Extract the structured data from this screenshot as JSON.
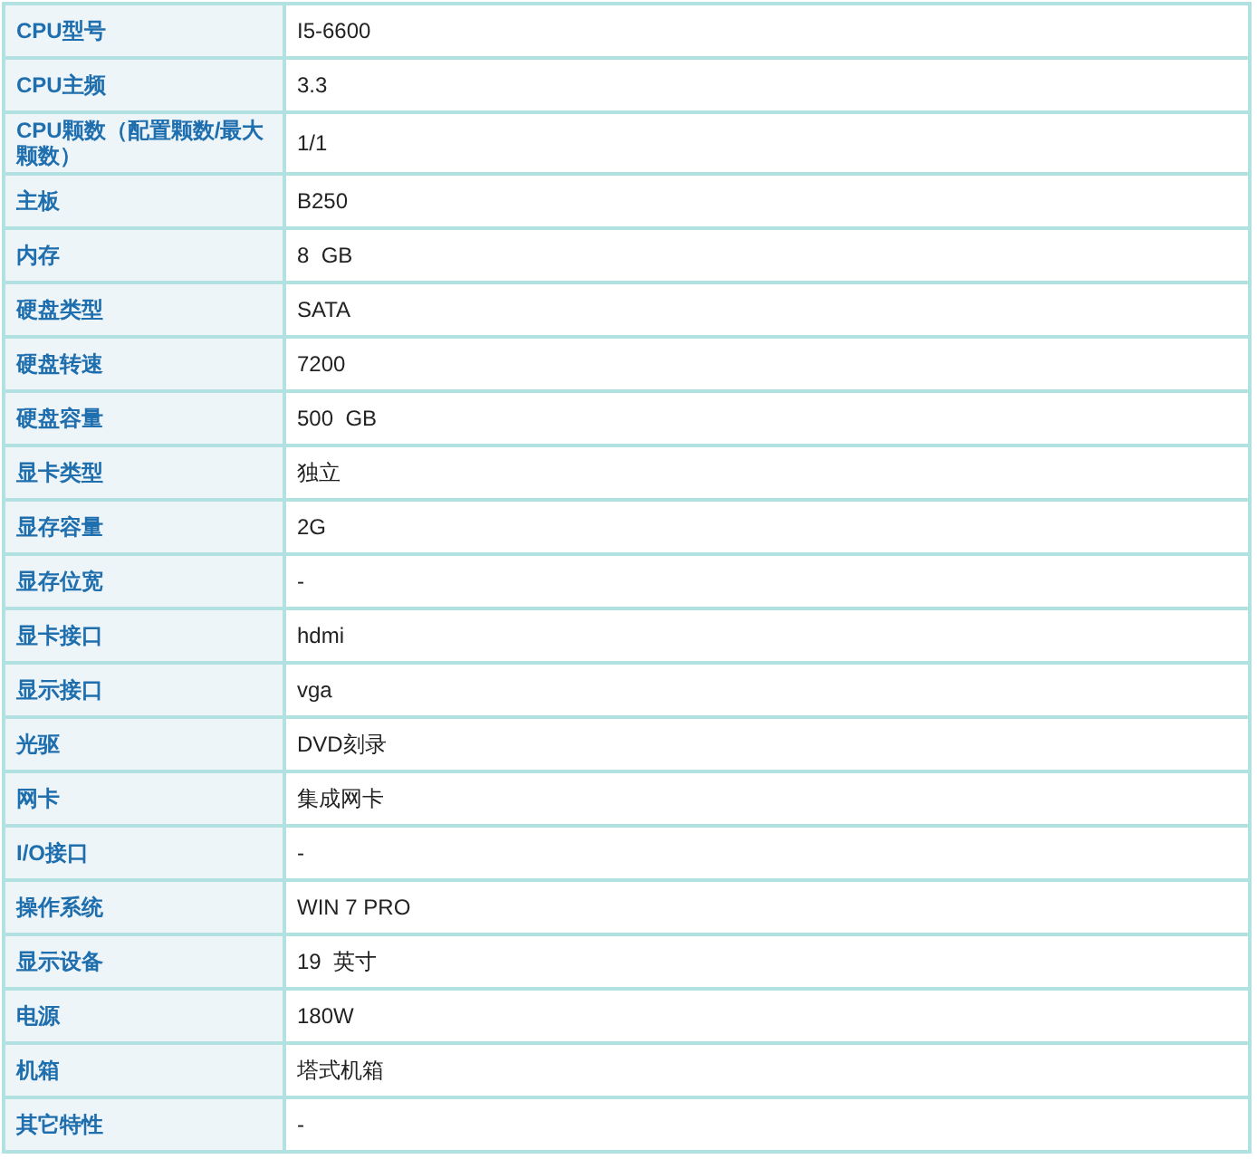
{
  "specs": [
    {
      "label": "CPU型号",
      "value": "I5-6600"
    },
    {
      "label": "CPU主频",
      "value": "3.3"
    },
    {
      "label": "CPU颗数（配置颗数/最大颗数）",
      "value": "1/1"
    },
    {
      "label": "主板",
      "value": "B250"
    },
    {
      "label": "内存",
      "value": "8  GB"
    },
    {
      "label": "硬盘类型",
      "value": "SATA"
    },
    {
      "label": "硬盘转速",
      "value": "7200"
    },
    {
      "label": "硬盘容量",
      "value": "500  GB"
    },
    {
      "label": "显卡类型",
      "value": "独立"
    },
    {
      "label": "显存容量",
      "value": "2G"
    },
    {
      "label": "显存位宽",
      "value": "-"
    },
    {
      "label": "显卡接口",
      "value": "hdmi"
    },
    {
      "label": "显示接口",
      "value": "vga"
    },
    {
      "label": "光驱",
      "value": "DVD刻录"
    },
    {
      "label": "网卡",
      "value": "集成网卡"
    },
    {
      "label": "I/O接口",
      "value": "-"
    },
    {
      "label": "操作系统",
      "value": "WIN 7 PRO"
    },
    {
      "label": "显示设备",
      "value": "19  英寸"
    },
    {
      "label": "电源",
      "value": "180W"
    },
    {
      "label": "机箱",
      "value": "塔式机箱"
    },
    {
      "label": "其它特性",
      "value": "-"
    }
  ]
}
